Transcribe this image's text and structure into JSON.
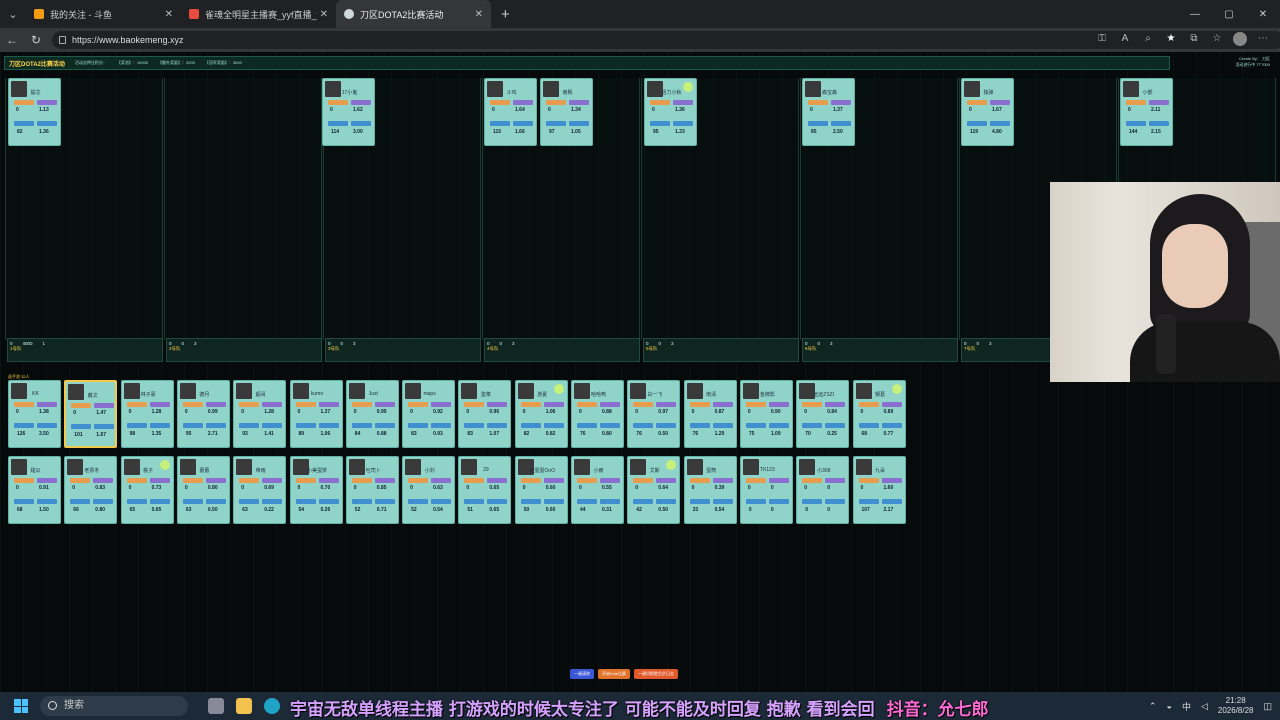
{
  "browser": {
    "tabs": [
      {
        "label": "我的关注 - 斗鱼",
        "color": "#f39c12"
      },
      {
        "label": "雀魂全明星主播赛_yyf直播_yyf",
        "color": "#e74c3c"
      },
      {
        "label": "刀区DOTA2比赛活动",
        "color": "#cfd8dc",
        "active": true
      }
    ],
    "url": "https://www.baokemeng.xyz",
    "win_min": "—",
    "win_max": "▢",
    "win_close": "✕"
  },
  "page": {
    "title": "刀区DOTA2比赛活动",
    "stats": [
      "活动总押注积分：",
      "【奖池】：10000",
      "【额外奖励】：2000",
      "【冠军奖励】：3000"
    ],
    "corner": [
      "Create By： 刀区",
      "活动进行中 7T7000"
    ],
    "top_cards": [
      {
        "name": "提芯",
        "v1": "0",
        "v2": "1.13",
        "v3": "82",
        "v4": "1.36"
      },
      {
        "name": "17小鬼",
        "v1": "0",
        "v2": "1.62",
        "v3": "114",
        "v4": "3.00"
      },
      {
        "name": "斗鸡",
        "v1": "0",
        "v2": "1.64",
        "v3": "115",
        "v4": "1.66"
      },
      {
        "name": "南枫",
        "v1": "0",
        "v2": "1.34",
        "v3": "97",
        "v4": "1.05"
      },
      {
        "name": "活力小秋",
        "v1": "0",
        "v2": "1.36",
        "v3": "95",
        "v4": "1.33"
      },
      {
        "name": "森宝森",
        "v1": "0",
        "v2": "1.37",
        "v3": "85",
        "v4": "2.50"
      },
      {
        "name": "独弹",
        "v1": "0",
        "v2": "1.67",
        "v3": "119",
        "v4": "4.80"
      },
      {
        "name": "小部",
        "v1": "0",
        "v2": "2.11",
        "v3": "144",
        "v4": "2.15"
      }
    ],
    "team_bars": [
      {
        "label": "1号队",
        "a": "0",
        "b": "4000",
        "c": "1"
      },
      {
        "label": "2号队",
        "a": "0",
        "b": "0",
        "c": "3"
      },
      {
        "label": "3号队",
        "a": "0",
        "b": "0",
        "c": "3"
      },
      {
        "label": "4号队",
        "a": "0",
        "b": "0",
        "c": "3"
      },
      {
        "label": "5号队",
        "a": "0",
        "b": "0",
        "c": "3"
      },
      {
        "label": "6号队",
        "a": "0",
        "b": "0",
        "c": "3"
      },
      {
        "label": "7号队",
        "a": "0",
        "b": "0",
        "c": "3"
      }
    ],
    "pool_label": "选手池 32人",
    "row1": [
      {
        "name": "KK",
        "v1": "0",
        "v2": "1.38",
        "v3": "126",
        "v4": "3.50"
      },
      {
        "name": "戴文",
        "v1": "0",
        "v2": "1.47",
        "v3": "101",
        "v4": "1.67"
      },
      {
        "name": "林子豪",
        "v1": "0",
        "v2": "1.28",
        "v3": "98",
        "v4": "1.35"
      },
      {
        "name": "德月",
        "v1": "0",
        "v2": "0.99",
        "v3": "95",
        "v4": "2.71"
      },
      {
        "name": "超哥",
        "v1": "0",
        "v2": "1.28",
        "v3": "93",
        "v4": "1.41"
      },
      {
        "name": "kumo",
        "v1": "0",
        "v2": "1.37",
        "v3": "89",
        "v4": "1.06"
      },
      {
        "name": "Just",
        "v1": "0",
        "v2": "0.99",
        "v3": "84",
        "v4": "0.88"
      },
      {
        "name": "maps",
        "v1": "0",
        "v2": "0.92",
        "v3": "83",
        "v4": "0.93"
      },
      {
        "name": "鉴菜",
        "v1": "0",
        "v2": "0.96",
        "v3": "83",
        "v4": "1.07"
      },
      {
        "name": "游夏",
        "v1": "0",
        "v2": "1.06",
        "v3": "82",
        "v4": "0.82"
      },
      {
        "name": "哈哈鸭",
        "v1": "0",
        "v2": "0.88",
        "v3": "76",
        "v4": "0.80"
      },
      {
        "name": "白一飞",
        "v1": "0",
        "v2": "0.97",
        "v3": "76",
        "v4": "0.50"
      },
      {
        "name": "南清",
        "v1": "0",
        "v2": "0.87",
        "v3": "76",
        "v4": "1.29"
      },
      {
        "name": "金牌影",
        "v1": "0",
        "v2": "0.90",
        "v3": "75",
        "v4": "1.09"
      },
      {
        "name": "远远ZSZI",
        "v1": "0",
        "v2": "0.84",
        "v3": "70",
        "v4": "0.25"
      },
      {
        "name": "钢葛",
        "v1": "0",
        "v2": "0.89",
        "v3": "68",
        "v4": "0.77"
      }
    ],
    "row2": [
      {
        "name": "甜瓜",
        "v1": "0",
        "v2": "0.91",
        "v3": "68",
        "v4": "1.50"
      },
      {
        "name": "老票冬",
        "v1": "0",
        "v2": "0.83",
        "v3": "66",
        "v4": "0.80"
      },
      {
        "name": "桃子",
        "v1": "0",
        "v2": "0.73",
        "v3": "65",
        "v4": "0.65"
      },
      {
        "name": "蕾蕾",
        "v1": "0",
        "v2": "0.80",
        "v3": "63",
        "v4": "0.50"
      },
      {
        "name": "帝雨",
        "v1": "0",
        "v2": "0.69",
        "v3": "63",
        "v4": "0.22"
      },
      {
        "name": "小美蛋饼",
        "v1": "0",
        "v2": "0.70",
        "v3": "54",
        "v4": "0.26"
      },
      {
        "name": "吐司卜",
        "v1": "0",
        "v2": "0.85",
        "v3": "52",
        "v4": "0.71"
      },
      {
        "name": "小刘",
        "v1": "0",
        "v2": "0.63",
        "v3": "52",
        "v4": "0.54"
      },
      {
        "name": "29",
        "v1": "0",
        "v2": "0.65",
        "v3": "51",
        "v4": "0.65"
      },
      {
        "name": "考蛋蛋OoO",
        "v1": "0",
        "v2": "0.60",
        "v3": "50",
        "v4": "0.60"
      },
      {
        "name": "小雨",
        "v1": "0",
        "v2": "0.55",
        "v3": "44",
        "v4": "0.31"
      },
      {
        "name": "艾斯",
        "v1": "0",
        "v2": "0.64",
        "v3": "42",
        "v4": "0.50"
      },
      {
        "name": "蛋筒",
        "v1": "0",
        "v2": "0.39",
        "v3": "33",
        "v4": "0.54"
      },
      {
        "name": "TK123",
        "v1": "0",
        "v2": "0",
        "v3": "0",
        "v4": "0"
      },
      {
        "name": "小308",
        "v1": "0",
        "v2": "0",
        "v3": "0",
        "v4": "0"
      },
      {
        "name": "九朵",
        "v1": "0",
        "v2": "1.60",
        "v3": "107",
        "v4": "2.17"
      }
    ],
    "footer_buttons": [
      {
        "label": "一键清除",
        "color": "#3a58d6"
      },
      {
        "label": "开始Vote比赛",
        "color": "#e0742b"
      },
      {
        "label": "一键切换胜负负日志",
        "color": "#e05a2b"
      }
    ]
  },
  "taskbar": {
    "search_placeholder": "搜索",
    "time": "21:28",
    "date": "2026/8/28",
    "ime": "中"
  },
  "subtitle": {
    "main": "宇宙无敌单线程主播 打游戏的时候太专注了 可能不能及时回复 抱歉 看到会回",
    "douyin": "抖音：允七郎"
  }
}
